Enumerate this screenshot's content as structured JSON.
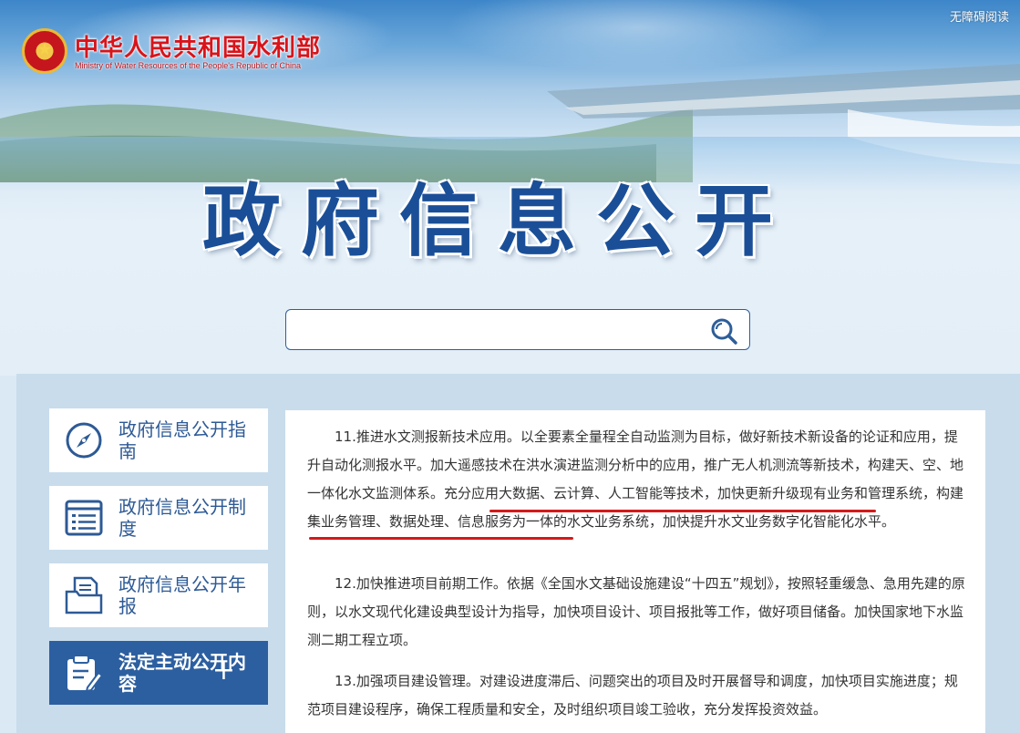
{
  "header": {
    "ministry_name_cn": "中华人民共和国水利部",
    "ministry_name_en": "Ministry of Water Resources of the People's Republic of China",
    "accessibility_label": "无障碍阅读",
    "emblem_icon": "national-emblem-icon",
    "banner_title": "政府信息公开"
  },
  "search": {
    "value": "",
    "placeholder": "",
    "icon": "search-icon"
  },
  "sidebar": {
    "items": [
      {
        "label": "政府信息公开指南",
        "icon": "compass-icon",
        "active": false
      },
      {
        "label": "政府信息公开制度",
        "icon": "list-document-icon",
        "active": false
      },
      {
        "label": "政府信息公开年报",
        "icon": "folder-document-icon",
        "active": false
      },
      {
        "label": "法定主动公开内容",
        "icon": "clipboard-edit-icon",
        "active": true,
        "expand_symbol": "+"
      }
    ]
  },
  "content": {
    "paragraphs": [
      "11.推进水文测报新技术应用。以全要素全量程全自动监测为目标，做好新技术新设备的论证和应用，提升自动化测报水平。加大遥感技术在洪水演进监测分析中的应用，推广无人机测流等新技术，构建天、空、地一体化水文监测体系。充分应用大数据、云计算、人工智能等技术，加快更新升级现有业务和管理系统，构建集业务管理、数据处理、信息服务为一体的水文业务系统，加快提升水文业务数字化智能化水平。",
      "12.加快推进项目前期工作。依据《全国水文基础设施建设“十四五”规划》，按照轻重缓急、急用先建的原则，以水文现代化建设典型设计为指导，加快项目设计、项目报批等工作，做好项目储备。加快国家地下水监测二期工程立项。",
      "13.加强项目建设管理。对建设进度滞后、问题突出的项目及时开展督导和调度，加快项目实施进度；规范项目建设程序，确保工程质量和安全，及时组织项目竣工验收，充分发挥投资效益。"
    ],
    "highlight_color": "#d21a1a"
  },
  "colors": {
    "brand_blue": "#2c5fa0",
    "title_blue": "#1a4f98",
    "ministry_red": "#d8141b"
  }
}
